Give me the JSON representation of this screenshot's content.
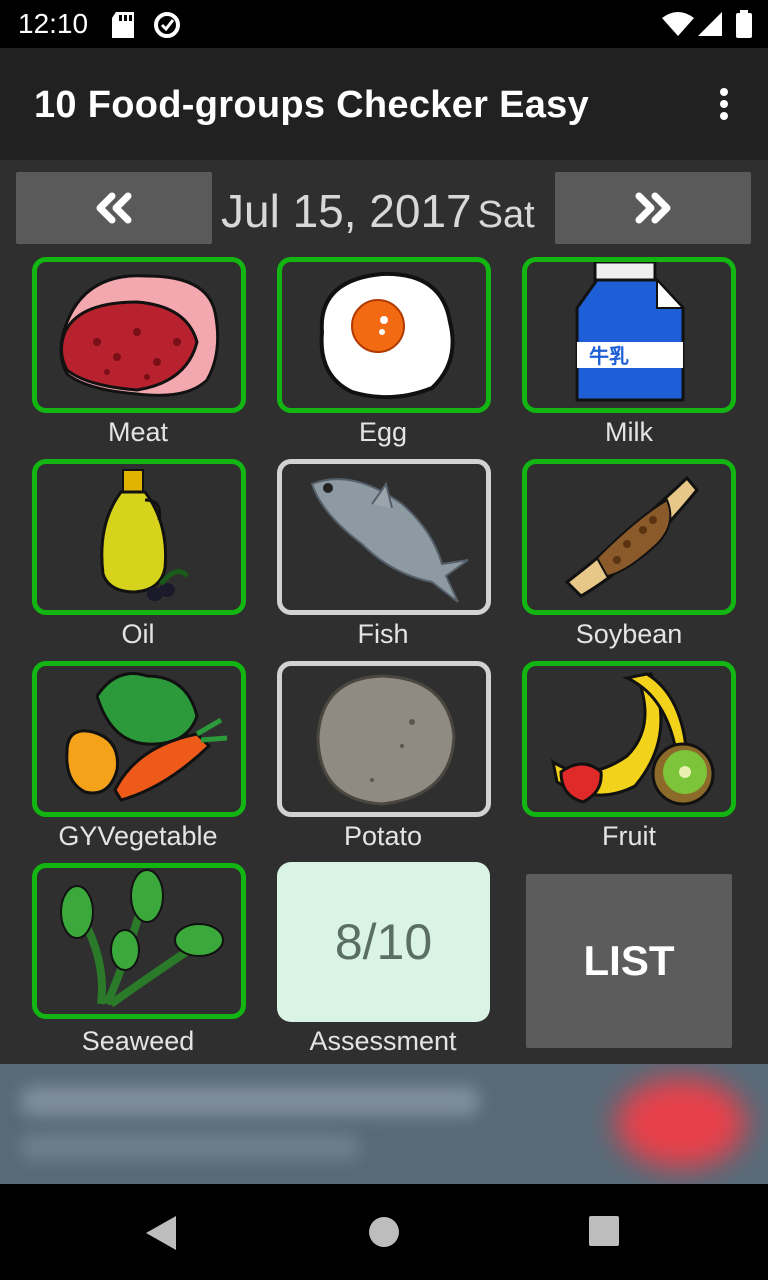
{
  "status_bar": {
    "time": "12:10",
    "icons": [
      "sd-card-icon",
      "data-saver-icon",
      "wifi-icon",
      "signal-icon",
      "battery-icon"
    ]
  },
  "app_bar": {
    "title": "10 Food-groups Checker Easy",
    "menu_icon": "more-vert-icon"
  },
  "date_nav": {
    "prev_icon": "double-chevron-left-icon",
    "date": "Jul 15, 2017",
    "weekday": "Sat",
    "next_icon": "double-chevron-right-icon"
  },
  "food_groups": [
    {
      "label": "Meat",
      "checked": true,
      "icon": "meat-icon"
    },
    {
      "label": "Egg",
      "checked": true,
      "icon": "fried-egg-icon"
    },
    {
      "label": "Milk",
      "checked": true,
      "icon": "milk-carton-icon",
      "carton_text": "牛乳"
    },
    {
      "label": "Oil",
      "checked": true,
      "icon": "olive-oil-icon"
    },
    {
      "label": "Fish",
      "checked": false,
      "icon": "fish-icon"
    },
    {
      "label": "Soybean",
      "checked": true,
      "icon": "natto-icon"
    },
    {
      "label": "GYVegetable",
      "checked": true,
      "icon": "vegetables-icon"
    },
    {
      "label": "Potato",
      "checked": false,
      "icon": "potato-icon"
    },
    {
      "label": "Fruit",
      "checked": true,
      "icon": "fruit-icon"
    },
    {
      "label": "Seaweed",
      "checked": true,
      "icon": "seaweed-icon"
    }
  ],
  "assessment": {
    "value": "8/10",
    "label": "Assessment"
  },
  "list_button": {
    "label": "LIST"
  },
  "colors": {
    "checked_border": "#12b512",
    "unchecked_border": "#d2d2d2",
    "assessment_bg": "#d9f3e5",
    "background": "#2f2f2f",
    "app_bar": "#212121"
  },
  "system_nav": {
    "icons": [
      "back-icon",
      "home-icon",
      "recents-icon"
    ]
  }
}
